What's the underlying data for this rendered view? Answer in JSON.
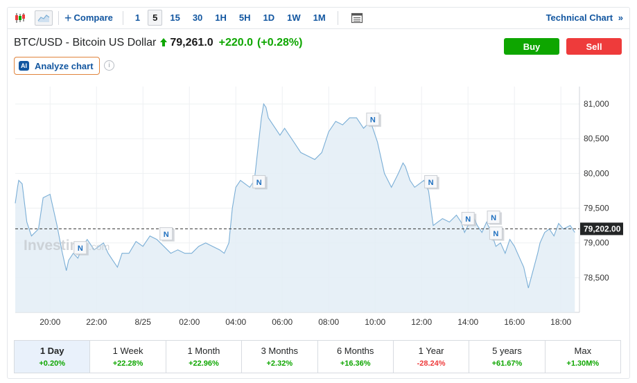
{
  "toolbar": {
    "compare_label": "Compare",
    "intervals": [
      "1",
      "5",
      "15",
      "30",
      "1H",
      "5H",
      "1D",
      "1W",
      "1M"
    ],
    "active_interval": "5",
    "technical_label": "Technical Chart",
    "technical_chevron": "»"
  },
  "header": {
    "name": "BTC/USD - Bitcoin US Dollar",
    "price": "79,261.0",
    "change": "+220.0",
    "change_pct": "(+0.28%)",
    "up_color": "#0ea600"
  },
  "actions": {
    "buy_label": "Buy",
    "sell_label": "Sell",
    "buy_color": "#0ea600",
    "sell_color": "#ee3b3b"
  },
  "analyze": {
    "badge": "AI",
    "label": "Analyze chart",
    "info_glyph": "i"
  },
  "watermark": {
    "brand": "Investing",
    "suffix": ".com"
  },
  "chart_data": {
    "type": "area",
    "x_ticks": [
      "20:00",
      "22:00",
      "8/25",
      "02:00",
      "04:00",
      "06:00",
      "08:00",
      "10:00",
      "12:00",
      "14:00",
      "16:00",
      "18:00"
    ],
    "x_tick_hours": [
      1.5,
      3.5,
      5.5,
      7.5,
      9.5,
      11.5,
      13.5,
      15.5,
      17.5,
      19.5,
      21.5,
      23.5
    ],
    "y_ticks": [
      "81,000",
      "80,500",
      "80,000",
      "79,500",
      "79,000",
      "78,500"
    ],
    "y_tick_values": [
      81000,
      80500,
      80000,
      79500,
      79000,
      78500
    ],
    "ylim": [
      78000,
      81250
    ],
    "xlim": [
      0,
      24.3
    ],
    "current_value": 79202,
    "current_label": "79,202.00",
    "line_color": "#7aaed6",
    "fill_color": "#e3edf6",
    "news_marker_label": "N",
    "news_markers": [
      {
        "x": 2.8,
        "y": 78920
      },
      {
        "x": 6.5,
        "y": 79120
      },
      {
        "x": 10.5,
        "y": 79870
      },
      {
        "x": 15.4,
        "y": 80770
      },
      {
        "x": 17.9,
        "y": 79870
      },
      {
        "x": 19.5,
        "y": 79340
      },
      {
        "x": 20.6,
        "y": 79360
      },
      {
        "x": 20.7,
        "y": 79130
      }
    ],
    "series": [
      {
        "x": [
          0.0,
          0.1,
          0.15,
          0.3,
          0.5,
          0.7,
          1.0,
          1.2,
          1.5,
          1.8,
          2.0,
          2.2,
          2.3,
          2.5,
          2.7,
          2.9,
          3.1,
          3.4,
          3.6,
          3.8,
          4.0,
          4.2,
          4.4,
          4.6,
          4.9,
          5.2,
          5.5,
          5.8,
          6.1,
          6.4,
          6.7,
          7.0,
          7.3,
          7.6,
          7.9,
          8.2,
          8.5,
          8.8,
          9.0,
          9.2,
          9.35,
          9.5,
          9.7,
          9.9,
          10.1,
          10.3,
          10.5,
          10.6,
          10.7,
          10.8,
          10.9,
          11.0,
          11.2,
          11.4,
          11.6,
          11.8,
          12.0,
          12.3,
          12.6,
          12.9,
          13.2,
          13.5,
          13.8,
          14.1,
          14.4,
          14.7,
          15.0,
          15.3,
          15.6,
          15.9,
          16.2,
          16.5,
          16.7,
          16.8,
          17.0,
          17.2,
          17.4,
          17.6,
          17.8,
          18.0,
          18.2,
          18.4,
          18.7,
          19.0,
          19.2,
          19.35,
          19.5,
          19.7,
          19.9,
          20.1,
          20.3,
          20.5,
          20.7,
          20.9,
          21.1,
          21.3,
          21.5,
          21.7,
          21.9,
          22.1,
          22.3,
          22.5,
          22.6,
          22.8,
          23.0,
          23.2,
          23.4,
          23.6,
          23.9,
          24.1
        ],
        "y": [
          79570,
          79800,
          79900,
          79850,
          79300,
          79100,
          79200,
          79650,
          79700,
          79250,
          78900,
          78600,
          78750,
          78850,
          78780,
          78950,
          79050,
          78900,
          78950,
          79000,
          78850,
          78750,
          78650,
          78850,
          78850,
          79020,
          78950,
          79100,
          79050,
          78950,
          78850,
          78900,
          78850,
          78850,
          78950,
          79000,
          78950,
          78900,
          78850,
          79000,
          79500,
          79800,
          79900,
          79850,
          79800,
          79900,
          80500,
          80800,
          81000,
          80950,
          80800,
          80750,
          80650,
          80550,
          80650,
          80550,
          80450,
          80300,
          80250,
          80200,
          80300,
          80600,
          80750,
          80700,
          80800,
          80800,
          80650,
          80750,
          80450,
          80000,
          79800,
          80000,
          80150,
          80100,
          79900,
          79800,
          79850,
          79900,
          79750,
          79250,
          79300,
          79350,
          79300,
          79400,
          79300,
          79150,
          79250,
          79400,
          79250,
          79150,
          79300,
          79150,
          78950,
          79000,
          78850,
          79050,
          78950,
          78800,
          78650,
          78350,
          78600,
          78850,
          79000,
          79150,
          79200,
          79100,
          79280,
          79200,
          79250,
          79150
        ]
      }
    ]
  },
  "periods": [
    {
      "label": "1 Day",
      "value": "+0.20%",
      "dir": "up"
    },
    {
      "label": "1 Week",
      "value": "+22.28%",
      "dir": "up"
    },
    {
      "label": "1 Month",
      "value": "+22.96%",
      "dir": "up"
    },
    {
      "label": "3 Months",
      "value": "+2.32%",
      "dir": "up"
    },
    {
      "label": "6 Months",
      "value": "+16.36%",
      "dir": "up"
    },
    {
      "label": "1 Year",
      "value": "-28.24%",
      "dir": "down"
    },
    {
      "label": "5 years",
      "value": "+61.67%",
      "dir": "up"
    },
    {
      "label": "Max",
      "value": "+1.30M%",
      "dir": "up"
    }
  ],
  "active_period": 0
}
